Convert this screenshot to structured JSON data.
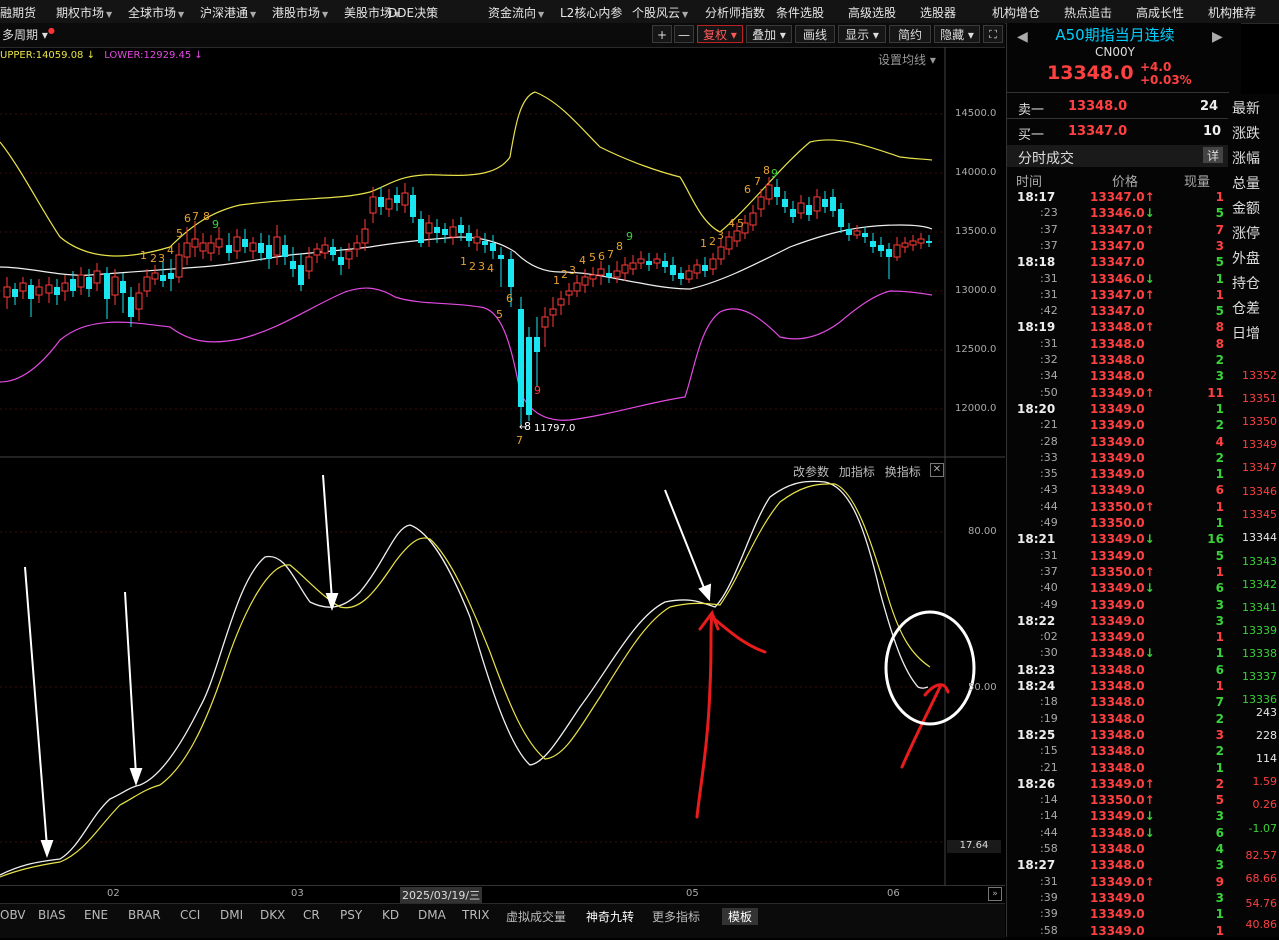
{
  "top_menu": [
    "融期货",
    "期权市场",
    "全球市场",
    "沪深港通",
    "港股市场",
    "美股市场",
    "DDE决策",
    "资金流向",
    "L2核心内参",
    "个股风云",
    "分析师指数",
    "条件选股",
    "高级选股",
    "选股器",
    "机构增仓",
    "热点追击",
    "高成长性",
    "机构推荐"
  ],
  "toolbar": {
    "period_label": "多周期",
    "plus": "+",
    "minus": "—",
    "fuquan": "复权",
    "overlay": "叠加",
    "draw": "画线",
    "display": "显示",
    "simple": "简约",
    "hide": "隐藏"
  },
  "indicator_bar": {
    "upper": "UPPER:14059.08",
    "lower": "LOWER:12929.45",
    "set_ma": "设置均线"
  },
  "price_axis": [
    "14500.0",
    "14000.0",
    "13500.0",
    "13000.0",
    "12500.0",
    "12000.0"
  ],
  "low_label": "11797.0",
  "sub_panel": {
    "change_params": "改参数",
    "add_indicator": "加指标",
    "switch_indicator": "换指标",
    "axis": [
      "80.00",
      "50.00"
    ],
    "current_value": "17.64"
  },
  "date_axis": [
    "02",
    "03",
    "2025/03/19/三",
    "05",
    "06"
  ],
  "bottom_tabs": [
    "OBV",
    "BIAS",
    "ENE",
    "BRAR",
    "CCI",
    "DMI",
    "DKX",
    "CR",
    "PSY",
    "KD",
    "DMA",
    "TRIX",
    "虚拟成交量",
    "神奇九转",
    "更多指标",
    "模板"
  ],
  "quote": {
    "name": "A50期指当月连续",
    "code": "CN00Y",
    "price": "13348.0",
    "change": "+4.0",
    "change_pct": "+0.03%",
    "sell1_label": "卖一",
    "sell1_price": "13348.0",
    "sell1_vol": "24",
    "buy1_label": "买一",
    "buy1_price": "13347.0",
    "buy1_vol": "10",
    "ticks_title": "分时成交",
    "detail": "详",
    "col_time": "时间",
    "col_price": "价格",
    "col_vol": "现量"
  },
  "ticks": [
    {
      "t": "18:17",
      "p": "13347.0",
      "d": "up",
      "v": "1"
    },
    {
      "t": ":23",
      "p": "13346.0",
      "d": "down",
      "v": "5"
    },
    {
      "t": ":37",
      "p": "13347.0",
      "d": "up",
      "v": "7"
    },
    {
      "t": ":37",
      "p": "13347.0",
      "d": "",
      "v": "3"
    },
    {
      "t": "18:18",
      "p": "13347.0",
      "d": "",
      "v": "5"
    },
    {
      "t": ":31",
      "p": "13346.0",
      "d": "down",
      "v": "1"
    },
    {
      "t": ":31",
      "p": "13347.0",
      "d": "up",
      "v": "1"
    },
    {
      "t": ":42",
      "p": "13347.0",
      "d": "",
      "v": "5"
    },
    {
      "t": "18:19",
      "p": "13348.0",
      "d": "up",
      "v": "8"
    },
    {
      "t": ":31",
      "p": "13348.0",
      "d": "",
      "v": "8"
    },
    {
      "t": ":32",
      "p": "13348.0",
      "d": "",
      "v": "2"
    },
    {
      "t": ":34",
      "p": "13348.0",
      "d": "",
      "v": "3"
    },
    {
      "t": ":50",
      "p": "13349.0",
      "d": "up",
      "v": "11"
    },
    {
      "t": "18:20",
      "p": "13349.0",
      "d": "",
      "v": "1"
    },
    {
      "t": ":21",
      "p": "13349.0",
      "d": "",
      "v": "2"
    },
    {
      "t": ":28",
      "p": "13349.0",
      "d": "",
      "v": "4"
    },
    {
      "t": ":33",
      "p": "13349.0",
      "d": "",
      "v": "2"
    },
    {
      "t": ":35",
      "p": "13349.0",
      "d": "",
      "v": "1"
    },
    {
      "t": ":43",
      "p": "13349.0",
      "d": "",
      "v": "6"
    },
    {
      "t": ":44",
      "p": "13350.0",
      "d": "up",
      "v": "1"
    },
    {
      "t": ":49",
      "p": "13350.0",
      "d": "",
      "v": "1"
    },
    {
      "t": "18:21",
      "p": "13349.0",
      "d": "down",
      "v": "16"
    },
    {
      "t": ":31",
      "p": "13349.0",
      "d": "",
      "v": "5"
    },
    {
      "t": ":37",
      "p": "13350.0",
      "d": "up",
      "v": "1"
    },
    {
      "t": ":40",
      "p": "13349.0",
      "d": "down",
      "v": "6"
    },
    {
      "t": ":49",
      "p": "13349.0",
      "d": "",
      "v": "3"
    },
    {
      "t": "18:22",
      "p": "13349.0",
      "d": "",
      "v": "3"
    },
    {
      "t": ":02",
      "p": "13349.0",
      "d": "",
      "v": "1"
    },
    {
      "t": ":30",
      "p": "13348.0",
      "d": "down",
      "v": "1"
    },
    {
      "t": "18:23",
      "p": "13348.0",
      "d": "",
      "v": "6"
    },
    {
      "t": "18:24",
      "p": "13348.0",
      "d": "",
      "v": "1"
    },
    {
      "t": ":18",
      "p": "13348.0",
      "d": "",
      "v": "7"
    },
    {
      "t": ":19",
      "p": "13348.0",
      "d": "",
      "v": "2"
    },
    {
      "t": "18:25",
      "p": "13348.0",
      "d": "",
      "v": "3"
    },
    {
      "t": ":15",
      "p": "13348.0",
      "d": "",
      "v": "2"
    },
    {
      "t": ":21",
      "p": "13348.0",
      "d": "",
      "v": "1"
    },
    {
      "t": "18:26",
      "p": "13349.0",
      "d": "up",
      "v": "2"
    },
    {
      "t": ":14",
      "p": "13350.0",
      "d": "up",
      "v": "5"
    },
    {
      "t": ":14",
      "p": "13349.0",
      "d": "down",
      "v": "3"
    },
    {
      "t": ":44",
      "p": "13348.0",
      "d": "down",
      "v": "6"
    },
    {
      "t": ":58",
      "p": "13348.0",
      "d": "",
      "v": "4"
    },
    {
      "t": "18:27",
      "p": "13348.0",
      "d": "",
      "v": "3"
    },
    {
      "t": ":31",
      "p": "13349.0",
      "d": "up",
      "v": "9"
    },
    {
      "t": ":39",
      "p": "13349.0",
      "d": "",
      "v": "3"
    },
    {
      "t": ":39",
      "p": "13349.0",
      "d": "",
      "v": "1"
    },
    {
      "t": ":58",
      "p": "13349.0",
      "d": "",
      "v": "1"
    }
  ],
  "side_labels": [
    "最新",
    "涨跌",
    "涨幅",
    "总量",
    "金额",
    "涨停",
    "外盘",
    "持仓",
    "仓差",
    "日增"
  ],
  "side_prices": [
    {
      "v": "13352",
      "c": "red"
    },
    {
      "v": "13351",
      "c": "red"
    },
    {
      "v": "13350",
      "c": "red"
    },
    {
      "v": "13349",
      "c": "red"
    },
    {
      "v": "13347",
      "c": "red"
    },
    {
      "v": "13346",
      "c": "red"
    },
    {
      "v": "13345",
      "c": "red"
    },
    {
      "v": "13344",
      "c": "white"
    },
    {
      "v": "13343",
      "c": "green"
    },
    {
      "v": "13342",
      "c": "green"
    },
    {
      "v": "13341",
      "c": "green"
    },
    {
      "v": "13339",
      "c": "green"
    },
    {
      "v": "13338",
      "c": "green"
    },
    {
      "v": "13337",
      "c": "green"
    },
    {
      "v": "13336",
      "c": "green"
    },
    {
      "v": "243",
      "c": "white"
    },
    {
      "v": "228",
      "c": "white"
    },
    {
      "v": "114",
      "c": "white"
    },
    {
      "v": "1.59",
      "c": "red"
    },
    {
      "v": "0.26",
      "c": "red"
    },
    {
      "v": "-1.07",
      "c": "green"
    },
    {
      "v": "82.57",
      "c": "red"
    },
    {
      "v": "68.66",
      "c": "red"
    },
    {
      "v": "54.76",
      "c": "red"
    },
    {
      "v": "40.86",
      "c": "red"
    }
  ],
  "colors": {
    "up": "#ff4040",
    "down": "#3ad23a",
    "upper": "#e8e24a",
    "lower": "#e24ae2",
    "kline_up": "#ff3b3b",
    "kline_down": "#19e6f0",
    "accent": "#00d0ff"
  }
}
